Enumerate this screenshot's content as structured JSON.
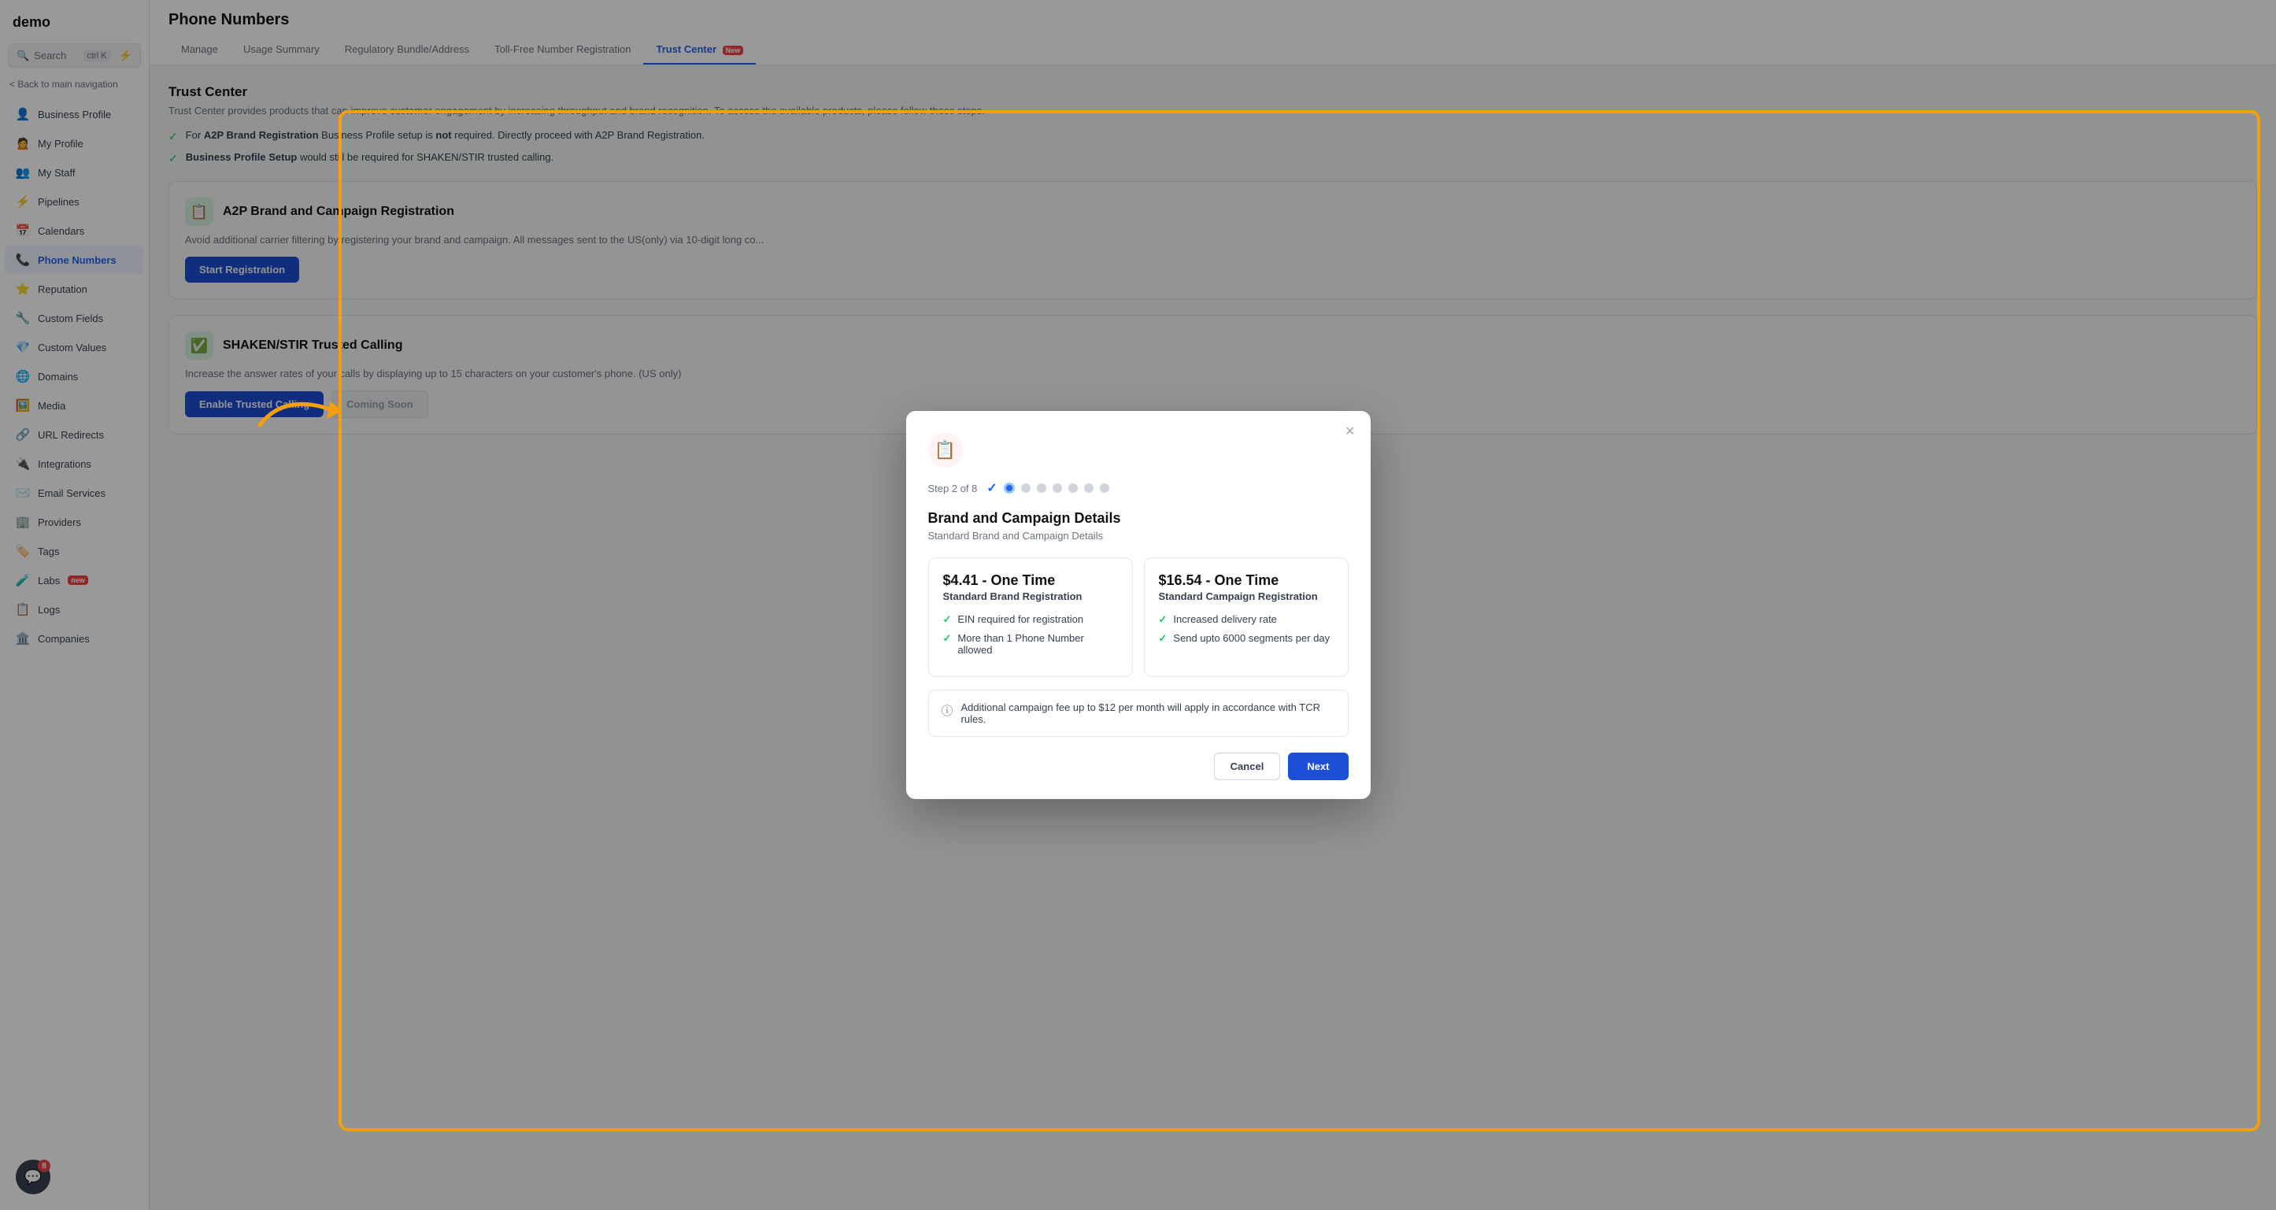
{
  "app": {
    "logo": "demo",
    "search_label": "Search",
    "search_shortcut": "ctrl K",
    "back_nav": "< Back to main navigation"
  },
  "sidebar": {
    "items": [
      {
        "id": "business-profile",
        "label": "Business Profile",
        "icon": "👤"
      },
      {
        "id": "my-profile",
        "label": "My Profile",
        "icon": "🙍"
      },
      {
        "id": "my-staff",
        "label": "My Staff",
        "icon": "👥"
      },
      {
        "id": "pipelines",
        "label": "Pipelines",
        "icon": "⚡"
      },
      {
        "id": "calendars",
        "label": "Calendars",
        "icon": "📅"
      },
      {
        "id": "phone-numbers",
        "label": "Phone Numbers",
        "icon": "📞",
        "active": true
      },
      {
        "id": "reputation",
        "label": "Reputation",
        "icon": "⭐"
      },
      {
        "id": "custom-fields",
        "label": "Custom Fields",
        "icon": "🔧"
      },
      {
        "id": "custom-values",
        "label": "Custom Values",
        "icon": "💎"
      },
      {
        "id": "domains",
        "label": "Domains",
        "icon": "🌐"
      },
      {
        "id": "media",
        "label": "Media",
        "icon": "🖼️"
      },
      {
        "id": "url-redirects",
        "label": "URL Redirects",
        "icon": "🔗"
      },
      {
        "id": "integrations",
        "label": "Integrations",
        "icon": "🔌"
      },
      {
        "id": "email-services",
        "label": "Email Services",
        "icon": "✉️"
      },
      {
        "id": "providers",
        "label": "Providers",
        "icon": "🏢"
      },
      {
        "id": "tags",
        "label": "Tags",
        "icon": "🏷️"
      },
      {
        "id": "labs",
        "label": "Labs",
        "icon": "🧪",
        "badge": "new"
      },
      {
        "id": "logs",
        "label": "Logs",
        "icon": "📋"
      },
      {
        "id": "companies",
        "label": "Companies",
        "icon": "🏛️"
      }
    ]
  },
  "header": {
    "title": "Phone Numbers",
    "tabs": [
      {
        "id": "manage",
        "label": "Manage"
      },
      {
        "id": "usage-summary",
        "label": "Usage Summary"
      },
      {
        "id": "regulatory",
        "label": "Regulatory Bundle/Address"
      },
      {
        "id": "toll-free",
        "label": "Toll-Free Number Registration"
      },
      {
        "id": "trust-center",
        "label": "Trust Center",
        "active": true,
        "badge": "New"
      }
    ]
  },
  "trust_center": {
    "title": "Trust Center",
    "description": "Trust Center provides products that can improve customer engagement by increasing throughput and brand recognition. To access the available products, please follow these steps.",
    "checklist": [
      {
        "text_bold": "A2P Brand Registration",
        "text_normal": " Business Profile setup is ",
        "text_bold2": "not",
        "text_end": " required. Directly proceed with A2P Brand Registration."
      },
      {
        "text_bold": "Business Profile Setup",
        "text_normal": " would still be required for SHAKEN/STIR trusted calling."
      }
    ],
    "a2p_section": {
      "icon": "📋",
      "title": "A2P Brand and Campaign Registration",
      "description": "Avoid additional carrier filtering by registering your brand and campaign. All messages sent to the US(only) via 10-digit long co...",
      "button_label": "Start Registration"
    },
    "shaken_section": {
      "icon": "✅",
      "title": "SHAKEN/STIR Trusted Calling",
      "description": "Increase the answer rates of your calls by displaying up to 15 characters on your customer's phone. (US only)",
      "button_label": "Enable Trusted Calling",
      "coming_soon_label": "Coming Soon"
    }
  },
  "modal": {
    "icon": "📋",
    "close_label": "×",
    "step_label": "Step 2 of 8",
    "title": "Brand and Campaign Details",
    "subtitle": "Standard Brand and Campaign Details",
    "pricing_card_1": {
      "price": "$4.41 - One Time",
      "plan_name": "Standard Brand Registration",
      "features": [
        "EIN required for registration",
        "More than 1 Phone Number allowed"
      ]
    },
    "pricing_card_2": {
      "price": "$16.54 - One Time",
      "plan_name": "Standard Campaign Registration",
      "features": [
        "Increased delivery rate",
        "Send upto 6000 segments per day"
      ]
    },
    "info_text": "Additional campaign fee up to $12 per month will apply in accordance with TCR rules.",
    "cancel_label": "Cancel",
    "next_label": "Next"
  },
  "chat": {
    "badge": "8"
  }
}
